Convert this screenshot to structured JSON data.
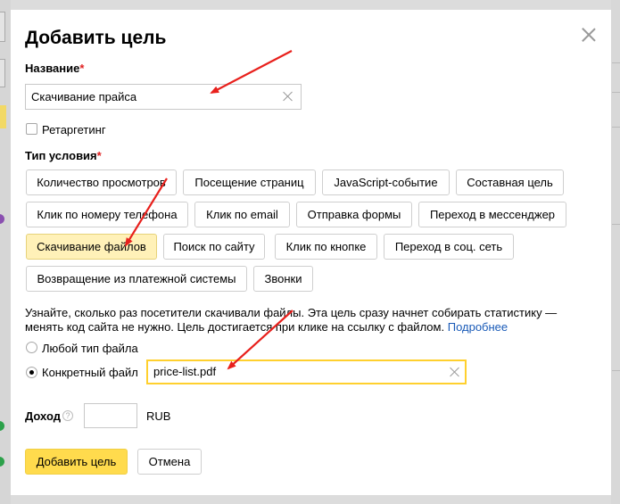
{
  "dialog": {
    "title": "Добавить цель"
  },
  "name_field": {
    "label": "Название",
    "required_mark": "*",
    "value": "Скачивание прайса"
  },
  "retargeting": {
    "label": "Ретаргетинг",
    "checked": false
  },
  "condition_type": {
    "label": "Тип условия",
    "required_mark": "*",
    "options": [
      "Количество просмотров",
      "Посещение страниц",
      "JavaScript-событие",
      "Составная цель",
      "Клик по номеру телефона",
      "Клик по email",
      "Отправка формы",
      "Переход в мессенджер",
      "Скачивание файлов",
      "Поиск по сайту",
      "Клик по кнопке",
      "Переход в соц. сеть",
      "Возвращение из платежной системы",
      "Звонки"
    ],
    "selected": "Скачивание файлов"
  },
  "hint": {
    "text": "Узнайте, сколько раз посетители скачивали файлы. Эта цель сразу начнет собирать статистику — менять код сайта не нужно. Цель достигается при клике на ссылку с файлом.",
    "link": "Подробнее"
  },
  "file_type": {
    "any_label": "Любой тип файла",
    "specific_label": "Конкретный файл",
    "selected": "specific",
    "file_value": "price-list.pdf"
  },
  "income": {
    "label": "Доход",
    "help": "?",
    "value": "",
    "currency": "RUB"
  },
  "actions": {
    "submit": "Добавить цель",
    "cancel": "Отмена"
  },
  "colors": {
    "accent_yellow": "#ffdb4d",
    "selected_chip": "#fff1b8",
    "required": "#e02020",
    "link": "#1a5bb8",
    "annotation_arrow": "#e8201c",
    "focus_border": "#ffd02e"
  }
}
